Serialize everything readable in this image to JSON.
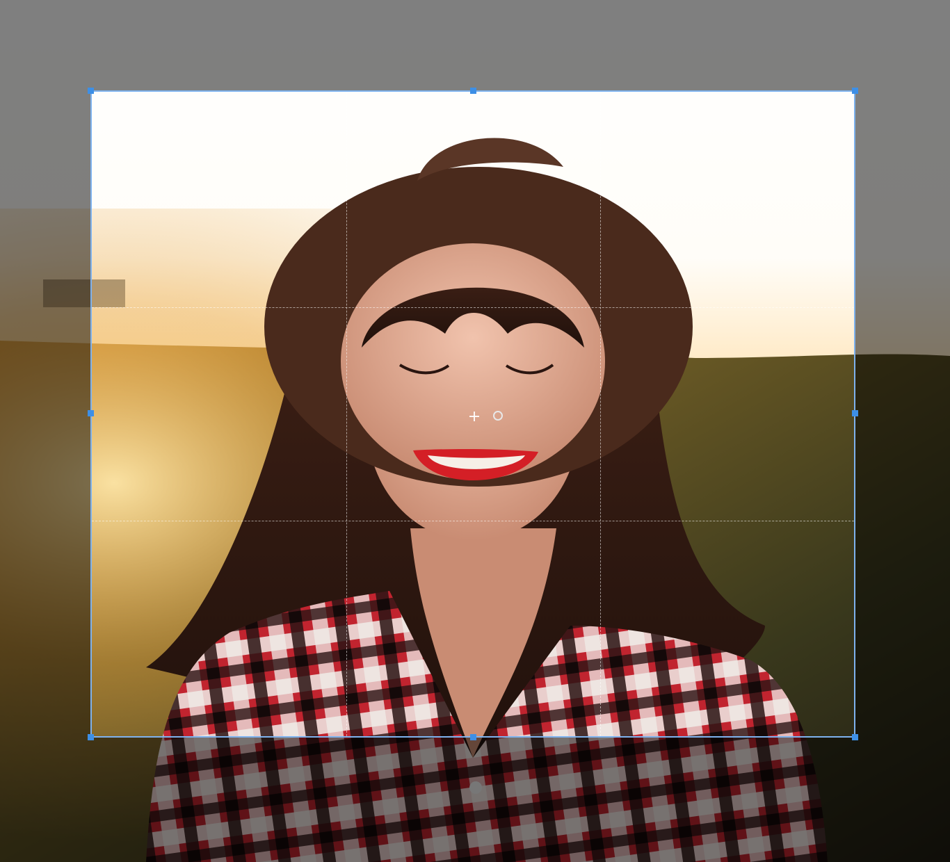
{
  "app": {
    "workspace_color": "#7f7f7f"
  },
  "image": {
    "icon": "photo-image",
    "description_hidden": ""
  },
  "crop": {
    "border_color": "#7eb2ee",
    "handle_color": "#3d8fe6",
    "grid": "rule-of-thirds",
    "center_icon": "crosshair-icon"
  }
}
